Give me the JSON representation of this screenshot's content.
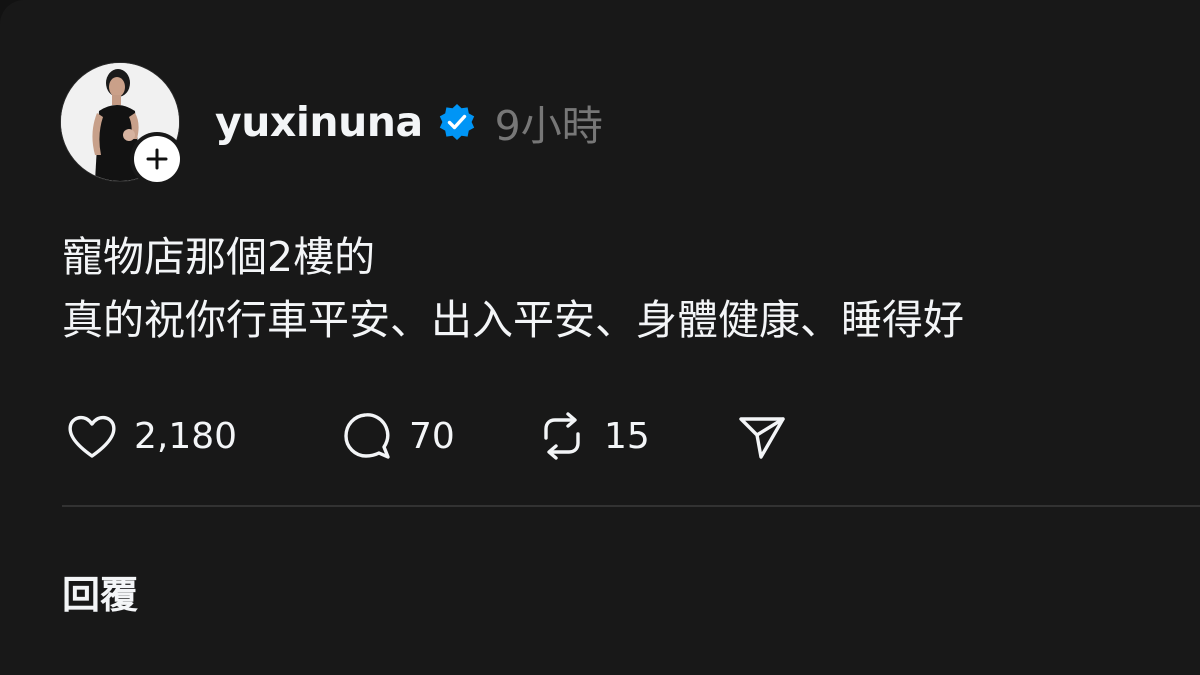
{
  "post": {
    "author": {
      "username": "yuxinuna",
      "verified": true,
      "avatar_icon": "profile-photo",
      "follow_icon": "plus-icon"
    },
    "timestamp": "9小時",
    "body_lines": [
      "寵物店那個2樓的",
      "真的祝你行車平安、出入平安、身體健康、睡得好"
    ],
    "actions": {
      "like": {
        "icon": "heart-icon",
        "count": "2,180"
      },
      "comment": {
        "icon": "comment-icon",
        "count": "70"
      },
      "repost": {
        "icon": "repost-icon",
        "count": "15"
      },
      "share": {
        "icon": "send-icon"
      }
    }
  },
  "reply": {
    "label": "回覆"
  },
  "colors": {
    "background": "#181818",
    "text": "#f3f5f7",
    "muted": "#777777",
    "verified": "#0095f6",
    "divider": "#323232"
  }
}
